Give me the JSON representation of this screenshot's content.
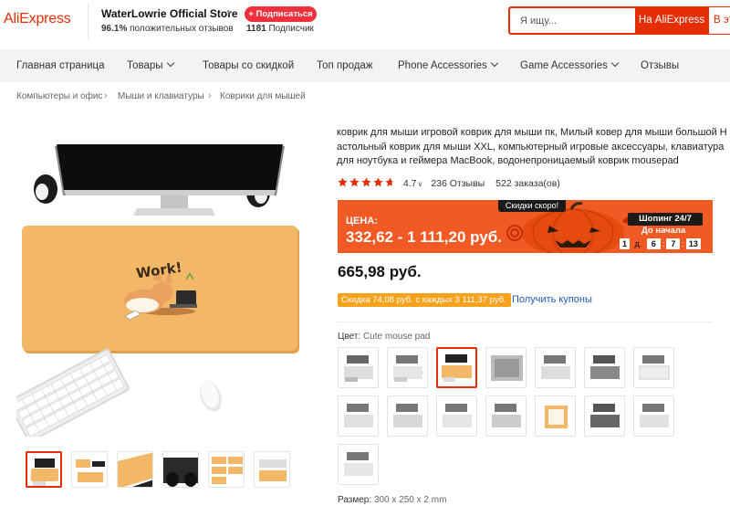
{
  "header": {
    "logo": "AliExpress",
    "store_name": "WaterLowrie Official Store",
    "positive_pct": "96.1%",
    "positive_text": "положительных отзывов",
    "subscribe_label": "+ Подписаться",
    "subscribers_count": "1181",
    "subscribers_text": "Подписчик",
    "search_placeholder": "Я ищу...",
    "search_button": "На AliExpress",
    "search_button_2": "В этом"
  },
  "nav": [
    {
      "label": "Главная страница",
      "dropdown": false
    },
    {
      "label": "Товары",
      "dropdown": true
    },
    {
      "label": "Товары со скидкой",
      "dropdown": false
    },
    {
      "label": "Топ продаж",
      "dropdown": false
    },
    {
      "label": "Phone Accessories",
      "dropdown": true
    },
    {
      "label": "Game Accessories",
      "dropdown": true
    },
    {
      "label": "Отзывы",
      "dropdown": false
    }
  ],
  "breadcrumb": [
    "Компьютеры и офис",
    "Мыши и клавиатуры",
    "Коврики для мышей"
  ],
  "breadcrumb_sep": "›",
  "product": {
    "title": "коврик для мыши игровой коврик для мыши пк, Милый ковер для мыши большой Настольный коврик для мыши XXL, компьютерный игровые аксессуары, клавиатура для ноутбука и геймера MacBook, водонепроницаемый коврик mousepad",
    "rating": "4.7",
    "rating_stars": 4.7,
    "reviews": "236 Отзывы",
    "orders": "522 заказа(ов)",
    "mat_text": "Work!",
    "promo": {
      "tag": "Скидки скоро!",
      "label": "ЦЕНА:",
      "price_range": "332,62 - 1 111,20 руб.",
      "shopping": "Шопинг 24/7",
      "starts_in": "До начала",
      "days": "1",
      "days_unit": "д.",
      "hours": "6",
      "minutes": "7",
      "seconds": "13",
      "sep": ":"
    },
    "price": "665,98 руб.",
    "discount": "Скидка 74,08 руб. с каждых 3 111,37 руб.",
    "coupons": "Получить купоны",
    "color_label": "Цвет:",
    "color_value": "Cute mouse pad",
    "size_label": "Размер:",
    "size_value": "300 x 250 x 2 mm"
  },
  "colors": {
    "accent": "#e62e04",
    "promo": "#f15a24",
    "discount": "#f7a21b",
    "link": "#1f5cb8",
    "mat": "#f2b867"
  }
}
